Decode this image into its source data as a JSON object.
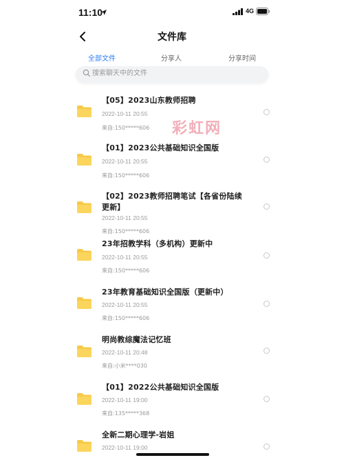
{
  "status_bar": {
    "time": "11:10",
    "network": "4G",
    "icons": [
      "location-arrow-icon",
      "signal-bars-icon",
      "battery-icon"
    ]
  },
  "nav": {
    "back_icon": "chevron-left-icon",
    "title": "文件库"
  },
  "tabs": [
    {
      "label": "全部文件",
      "active": true
    },
    {
      "label": "分享人",
      "active": false
    },
    {
      "label": "分享时间",
      "active": false
    }
  ],
  "search": {
    "placeholder": "搜索聊天中的文件"
  },
  "watermark": "彩虹网",
  "colors": {
    "accent": "#2f7ef6",
    "folder": "#f7c948",
    "watermark": "#e7566b"
  },
  "files": [
    {
      "name": "【05】2023山东教师招聘",
      "date": "2022-10-11 20:55",
      "source": "来自:150*****606"
    },
    {
      "name": "【01】2023公共基础知识全国版",
      "date": "2022-10-11 20:55",
      "source": "来自:150*****606"
    },
    {
      "name": "【02】2023教师招聘笔试【各省份陆续更新】",
      "date": "2022-10-11 20:55",
      "source": "来自:150*****606"
    },
    {
      "name": "23年招教学科（多机构）更新中",
      "date": "2022-10-11 20:55",
      "source": "来自:150*****606"
    },
    {
      "name": "23年教育基础知识全国版（更新中）",
      "date": "2022-10-11 20:55",
      "source": "来自:150*****606"
    },
    {
      "name": "明尚教综魔法记忆班",
      "date": "2022-10-11 20:48",
      "source": "来自:小米****030"
    },
    {
      "name": "【01】2022公共基础知识全国版",
      "date": "2022-10-11 19:00",
      "source": "来自:135*****368"
    },
    {
      "name": "全新二期心理学-岩姐",
      "date": "2022-10-11 19:00",
      "source": ""
    }
  ]
}
